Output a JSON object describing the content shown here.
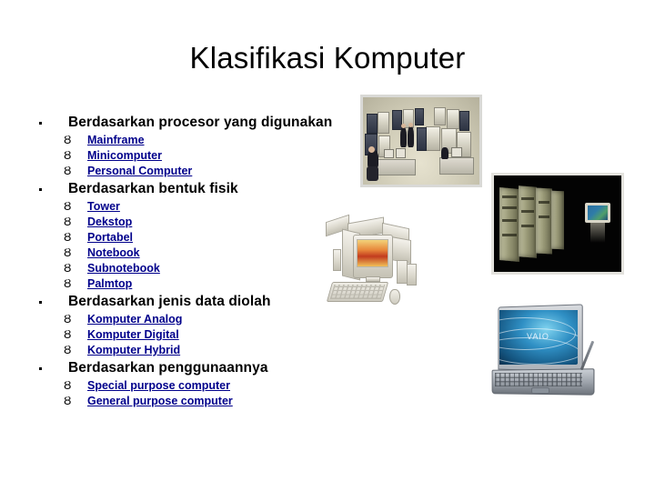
{
  "slide": {
    "title": "Klasifikasi Komputer",
    "bullet_glyph": "Ȣ",
    "link_color": "#00008B",
    "text_color": "#000000",
    "background": "#ffffff"
  },
  "sections": [
    {
      "heading": "Berdasarkan procesor yang digunakan",
      "items": [
        {
          "label": "Mainframe"
        },
        {
          "label": "Minicomputer"
        },
        {
          "label": "Personal Computer"
        }
      ]
    },
    {
      "heading": "Berdasarkan bentuk fisik",
      "items": [
        {
          "label": "Tower"
        },
        {
          "label": "Dekstop"
        },
        {
          "label": "Portabel"
        },
        {
          "label": "Notebook"
        },
        {
          "label": "Subnotebook"
        },
        {
          "label": "Palmtop"
        }
      ]
    },
    {
      "heading": "Berdasarkan jenis data diolah",
      "items": [
        {
          "label": "Komputer Analog"
        },
        {
          "label": "Komputer Digital"
        },
        {
          "label": "Komputer Hybrid"
        }
      ]
    },
    {
      "heading": "Berdasarkan penggunaannya",
      "items": [
        {
          "label": "Special purpose computer"
        },
        {
          "label": "General purpose computer"
        }
      ]
    }
  ],
  "images": [
    {
      "id": "mainframe",
      "name": "mainframe-computer-room-photo"
    },
    {
      "id": "serverroom",
      "name": "dark-server-room-photo"
    },
    {
      "id": "desktop",
      "name": "desktop-pc-illustration"
    },
    {
      "id": "laptop",
      "name": "laptop-notebook-illustration"
    }
  ],
  "laptop": {
    "brand_text": "VAIO"
  }
}
